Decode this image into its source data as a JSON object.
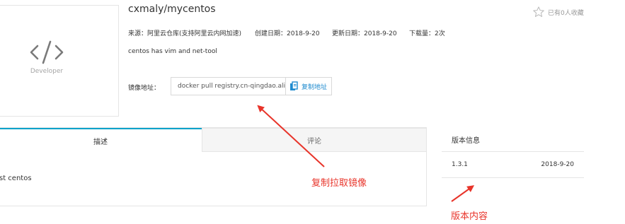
{
  "logo": {
    "label": "Developer",
    "icon": "code-slash-icon"
  },
  "repo": {
    "title": "cxmaly/mycentos",
    "source": "来源：阿里云仓库(支持阿里云内网加速)",
    "created": "创建日期：2018-9-20",
    "updated": "更新日期：2018-9-20",
    "downloads": "下载量：2次",
    "description": "centos has vim and net-tool"
  },
  "favorite": {
    "label": "已有0人收藏",
    "icon": "star-outline-icon"
  },
  "address": {
    "label": "镜像地址：",
    "value": "docker pull registry.cn-qingdao.aliy...",
    "copy_label": "复制地址",
    "copy_icon": "copy-icon"
  },
  "tabs": [
    {
      "label": "描述",
      "active": true
    },
    {
      "label": "评论",
      "active": false
    }
  ],
  "tab_content": "st centos",
  "version": {
    "title": "版本信息",
    "rows": [
      {
        "tag": "1.3.1",
        "date": "2018-9-20"
      }
    ]
  },
  "annotations": [
    "复制拉取镜像",
    "版本内容"
  ],
  "colors": {
    "accent": "#00a2ca",
    "link": "#1f8bcf",
    "annotation": "#e8342a"
  }
}
